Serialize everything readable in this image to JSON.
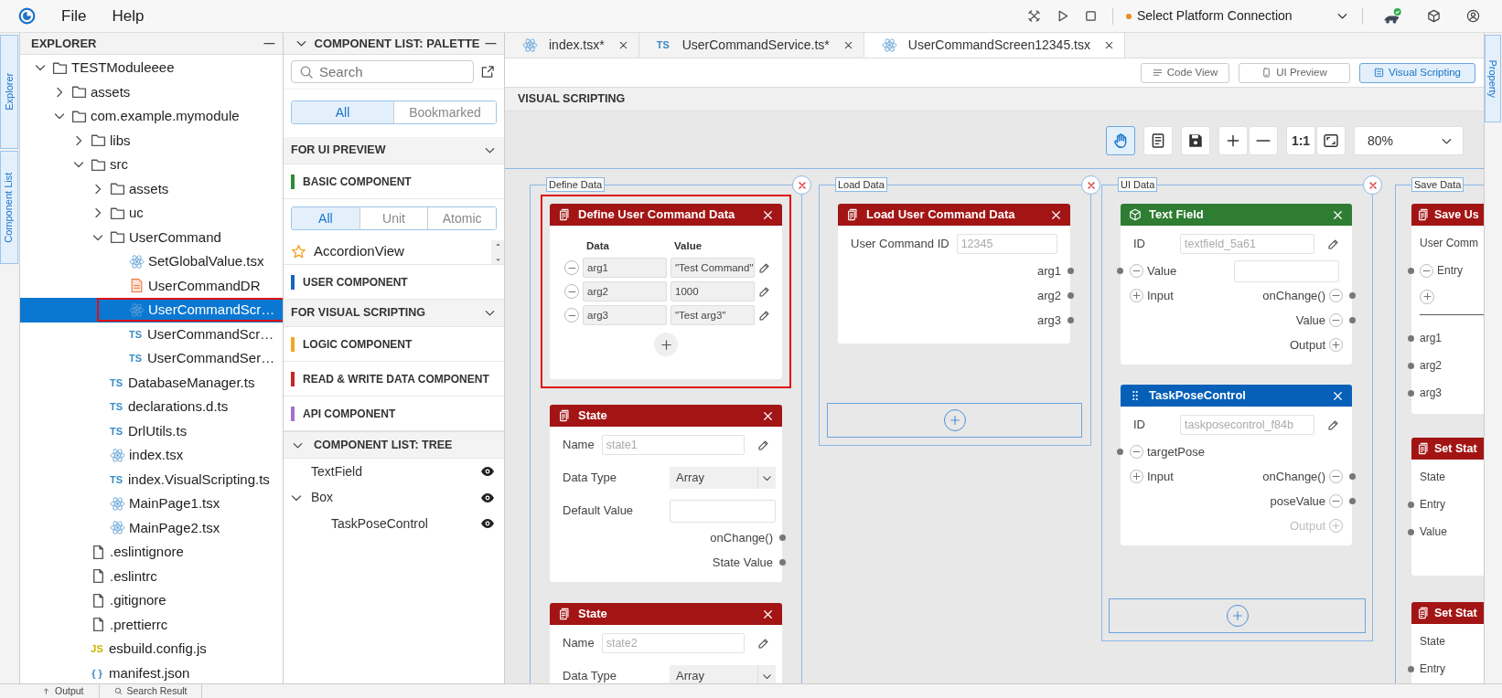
{
  "menu_bar": {
    "items": [
      {
        "label": "File"
      },
      {
        "label": "Help"
      }
    ],
    "platform_connection": {
      "label": "Select Platform Connection",
      "color": "#f08a24"
    }
  },
  "left_rail": [
    {
      "label": "Explorer"
    },
    {
      "label": "Component List"
    }
  ],
  "explorer": {
    "title": "EXPLORER",
    "tree": [
      {
        "label": "TESTModuleeee",
        "kind": "folder",
        "expanded": true,
        "selected": false,
        "children": [
          {
            "label": "assets",
            "kind": "folder",
            "expanded": false,
            "selected": false
          },
          {
            "label": "com.example.mymodule",
            "kind": "folder",
            "expanded": true,
            "selected": false,
            "children": [
              {
                "label": "libs",
                "kind": "folder",
                "expanded": false,
                "selected": false
              },
              {
                "label": "src",
                "kind": "folder",
                "expanded": true,
                "selected": false,
                "children": [
                  {
                    "label": "assets",
                    "kind": "folder",
                    "expanded": false,
                    "selected": false
                  },
                  {
                    "label": "uc",
                    "kind": "folder",
                    "expanded": false,
                    "selected": false
                  },
                  {
                    "label": "UserCommand",
                    "kind": "folder",
                    "expanded": true,
                    "selected": false,
                    "children": [
                      {
                        "label": "SetGlobalValue.tsx",
                        "kind": "react",
                        "selected": false
                      },
                      {
                        "label": "UserCommandDR",
                        "kind": "pdf",
                        "selected": false
                      },
                      {
                        "label": "UserCommandScr…",
                        "kind": "react",
                        "selected": true,
                        "highlighted": true
                      },
                      {
                        "label": "UserCommandScr…",
                        "kind": "text",
                        "icon_text": "TS",
                        "selected": false
                      },
                      {
                        "label": "UserCommandSer…",
                        "kind": "text",
                        "icon_text": "TS",
                        "selected": false
                      }
                    ]
                  },
                  {
                    "label": "DatabaseManager.ts",
                    "kind": "text",
                    "icon_text": "TS",
                    "selected": false
                  },
                  {
                    "label": "declarations.d.ts",
                    "kind": "text",
                    "icon_text": "TS",
                    "selected": false
                  },
                  {
                    "label": "DrlUtils.ts",
                    "kind": "text",
                    "icon_text": "TS",
                    "selected": false
                  },
                  {
                    "label": "index.tsx",
                    "kind": "react",
                    "selected": false
                  },
                  {
                    "label": "index.VisualScripting.ts",
                    "kind": "text",
                    "icon_text": "TS",
                    "selected": false
                  },
                  {
                    "label": "MainPage1.tsx",
                    "kind": "react",
                    "selected": false
                  },
                  {
                    "label": "MainPage2.tsx",
                    "kind": "react",
                    "selected": false
                  }
                ]
              },
              {
                "label": ".eslintignore",
                "kind": "file",
                "selected": false
              },
              {
                "label": ".eslintrc",
                "kind": "file",
                "selected": false
              },
              {
                "label": ".gitignore",
                "kind": "file",
                "selected": false
              },
              {
                "label": ".prettierrc",
                "kind": "file",
                "selected": false
              },
              {
                "label": "esbuild.config.js",
                "kind": "text",
                "icon_text": "JS",
                "selected": false
              },
              {
                "label": "manifest.json",
                "kind": "text",
                "icon_text": "{ }",
                "selected": false
              }
            ]
          }
        ]
      }
    ]
  },
  "palette": {
    "title": "COMPONENT LIST: PALETTE",
    "search_placeholder": "Search",
    "filters": [
      {
        "label": "All",
        "selected": true
      },
      {
        "label": "Bookmarked",
        "selected": false
      }
    ],
    "rows": [
      {
        "kind": "section",
        "label": "FOR UI PREVIEW",
        "expanded": true
      },
      {
        "kind": "category",
        "label": "BASIC COMPONENT",
        "color": "#2e8b3a"
      },
      {
        "kind": "segmented",
        "options": [
          {
            "label": "All",
            "selected": true
          },
          {
            "label": "Unit",
            "selected": false
          },
          {
            "label": "Atomic",
            "selected": false
          }
        ]
      },
      {
        "kind": "item",
        "label": "AccordionView",
        "bookmarked": false
      },
      {
        "kind": "category",
        "label": "USER COMPONENT",
        "color": "#1565c0"
      },
      {
        "kind": "section",
        "label": "FOR VISUAL SCRIPTING",
        "expanded": true
      },
      {
        "kind": "category",
        "label": "LOGIC COMPONENT",
        "color": "#f5a623"
      },
      {
        "kind": "category",
        "label": "READ & WRITE DATA COMPONENT",
        "color": "#c62828"
      },
      {
        "kind": "category",
        "label": "API COMPONENT",
        "color": "#a070d0"
      }
    ]
  },
  "component_tree": {
    "title": "COMPONENT LIST: TREE",
    "expanded": true,
    "items": [
      {
        "label": "TextField",
        "visible": true
      },
      {
        "label": "Box",
        "expanded": true,
        "visible": true,
        "children": [
          {
            "label": "TaskPoseControl",
            "visible": true
          }
        ]
      }
    ]
  },
  "editor_tabs": [
    {
      "label": "index.tsx*",
      "kind": "react",
      "selected": false
    },
    {
      "label": "UserCommandService.ts*",
      "kind": "text",
      "icon_text": "TS",
      "selected": false
    },
    {
      "label": "UserCommandScreen12345.tsx",
      "kind": "react",
      "selected": true
    }
  ],
  "view_buttons": [
    {
      "label": "Code View",
      "kind": "lines",
      "selected": false
    },
    {
      "label": "UI Preview",
      "kind": "phone",
      "selected": false
    },
    {
      "label": "Visual Scripting",
      "kind": "frame",
      "selected": true
    }
  ],
  "section_title": "VISUAL SCRIPTING",
  "canvas_toolbar": {
    "tools": [
      {
        "kind": "hand",
        "selected": true
      },
      {
        "kind": "document",
        "selected": false
      },
      {
        "kind": "save",
        "selected": false
      },
      {
        "kind": "plus",
        "selected": false
      },
      {
        "kind": "minus",
        "selected": false
      },
      {
        "text": "1:1",
        "selected": false
      },
      {
        "kind": "fit",
        "selected": false
      }
    ],
    "zoom": "80%"
  },
  "groups": [
    {
      "label": "Define Data",
      "closable": true,
      "nodes": [
        {
          "kind": "define",
          "title": "Define User Command Data",
          "color": "#a31515",
          "selected": true,
          "columns": [
            "Data",
            "Value"
          ],
          "rows": [
            {
              "data": "arg1",
              "value": "\"Test Command\""
            },
            {
              "data": "arg2",
              "value": "1000"
            },
            {
              "data": "arg3",
              "value": "\"Test arg3\""
            }
          ]
        },
        {
          "kind": "data",
          "title": "State",
          "color": "#a31515",
          "selected": false,
          "rows": [
            {
              "kind": "field",
              "label": "Name",
              "placeholder": "state1",
              "editable": true
            },
            {
              "kind": "select",
              "label": "Data Type",
              "value": "Array"
            },
            {
              "kind": "input",
              "label": "Default Value"
            },
            {
              "kind": "port",
              "right": {
                "label": "onChange()",
                "dot": true,
                "disabled": false
              }
            },
            {
              "kind": "port",
              "right": {
                "label": "State Value",
                "dot": true,
                "disabled": false
              }
            }
          ]
        },
        {
          "kind": "data",
          "title": "State",
          "color": "#a31515",
          "selected": false,
          "rows": [
            {
              "kind": "field",
              "label": "Name",
              "placeholder": "state2",
              "editable": true
            },
            {
              "kind": "select",
              "label": "Data Type",
              "value": "Array"
            }
          ]
        }
      ]
    },
    {
      "label": "Load Data",
      "closable": true,
      "add_slot": true,
      "nodes": [
        {
          "kind": "data",
          "title": "Load User Command Data",
          "color": "#a31515",
          "selected": false,
          "rows": [
            {
              "kind": "field",
              "label": "User Command ID",
              "placeholder": "12345",
              "editable": false
            },
            {
              "kind": "port",
              "right": {
                "label": "arg1",
                "dot": true,
                "disabled": false
              }
            },
            {
              "kind": "port",
              "right": {
                "label": "arg2",
                "dot": true,
                "disabled": false
              }
            },
            {
              "kind": "port",
              "right": {
                "label": "arg3",
                "dot": true,
                "disabled": false
              }
            }
          ]
        }
      ]
    },
    {
      "label": "UI Data",
      "closable": true,
      "add_slot": true,
      "nodes": [
        {
          "kind": "component",
          "title": "Text Field",
          "color": "#2e7d32",
          "selected": false,
          "rows": [
            {
              "kind": "field",
              "label": "ID",
              "placeholder": "textfield_5a61",
              "editable": true
            },
            {
              "kind": "port",
              "left": {
                "label": "Value",
                "kind": "remove",
                "dot": true,
                "has_input": true,
                "disabled": false
              }
            },
            {
              "kind": "port",
              "left": {
                "label": "Input",
                "kind": "add",
                "dot": false,
                "disabled": false
              },
              "right": {
                "label": "onChange()",
                "kind": "remove",
                "dot": true,
                "disabled": false
              }
            },
            {
              "kind": "port",
              "right": {
                "label": "Value",
                "kind": "remove",
                "dot": true,
                "disabled": false
              }
            },
            {
              "kind": "port",
              "right": {
                "label": "Output",
                "kind": "add",
                "dot": false,
                "disabled": false
              }
            }
          ]
        },
        {
          "kind": "control",
          "title": "TaskPoseControl",
          "color": "#0660b8",
          "selected": false,
          "rows": [
            {
              "kind": "field",
              "label": "ID",
              "placeholder": "taskposecontrol_f84b",
              "editable": true
            },
            {
              "kind": "port",
              "left": {
                "label": "targetPose",
                "kind": "remove",
                "dot": true,
                "disabled": false
              }
            },
            {
              "kind": "port",
              "left": {
                "label": "Input",
                "kind": "add",
                "dot": false,
                "disabled": false
              },
              "right": {
                "label": "onChange()",
                "kind": "remove",
                "dot": true,
                "disabled": false
              }
            },
            {
              "kind": "port",
              "right": {
                "label": "poseValue",
                "kind": "remove",
                "dot": true,
                "disabled": false
              }
            },
            {
              "kind": "port",
              "right": {
                "label": "Output",
                "kind": "add",
                "dot": false,
                "disabled": true
              }
            }
          ]
        }
      ]
    },
    {
      "label": "Save Data",
      "closable": false,
      "nodes": [
        {
          "kind": "data",
          "title": "Save Us",
          "color": "#a31515",
          "selected": false,
          "rows": [
            {
              "kind": "label",
              "label": "User Comm"
            },
            {
              "kind": "port",
              "left": {
                "label": "Entry",
                "kind": "remove",
                "dot": true,
                "disabled": false
              }
            },
            {
              "kind": "add"
            },
            {
              "kind": "divider"
            },
            {
              "kind": "port",
              "left": {
                "label": "arg1",
                "dot": true,
                "disabled": false
              }
            },
            {
              "kind": "port",
              "left": {
                "label": "arg2",
                "dot": true,
                "disabled": false
              }
            },
            {
              "kind": "port",
              "left": {
                "label": "arg3",
                "dot": true,
                "disabled": false
              }
            }
          ]
        },
        {
          "kind": "data",
          "title": "Set Stat",
          "color": "#a31515",
          "selected": false,
          "rows": [
            {
              "kind": "label",
              "label": "State"
            },
            {
              "kind": "port",
              "left": {
                "label": "Entry",
                "dot": true,
                "disabled": false
              }
            },
            {
              "kind": "port",
              "left": {
                "label": "Value",
                "dot": true,
                "disabled": false
              }
            }
          ]
        },
        {
          "kind": "data",
          "title": "Set Stat",
          "color": "#a31515",
          "selected": false,
          "rows": [
            {
              "kind": "label",
              "label": "State"
            },
            {
              "kind": "port",
              "left": {
                "label": "Entry",
                "dot": true,
                "disabled": false
              }
            }
          ]
        }
      ]
    }
  ],
  "right_rail": {
    "label": "Property"
  },
  "bottom_tabs": [
    {
      "label": "Output",
      "kind": "output"
    },
    {
      "label": "Search Result",
      "kind": "search"
    }
  ]
}
